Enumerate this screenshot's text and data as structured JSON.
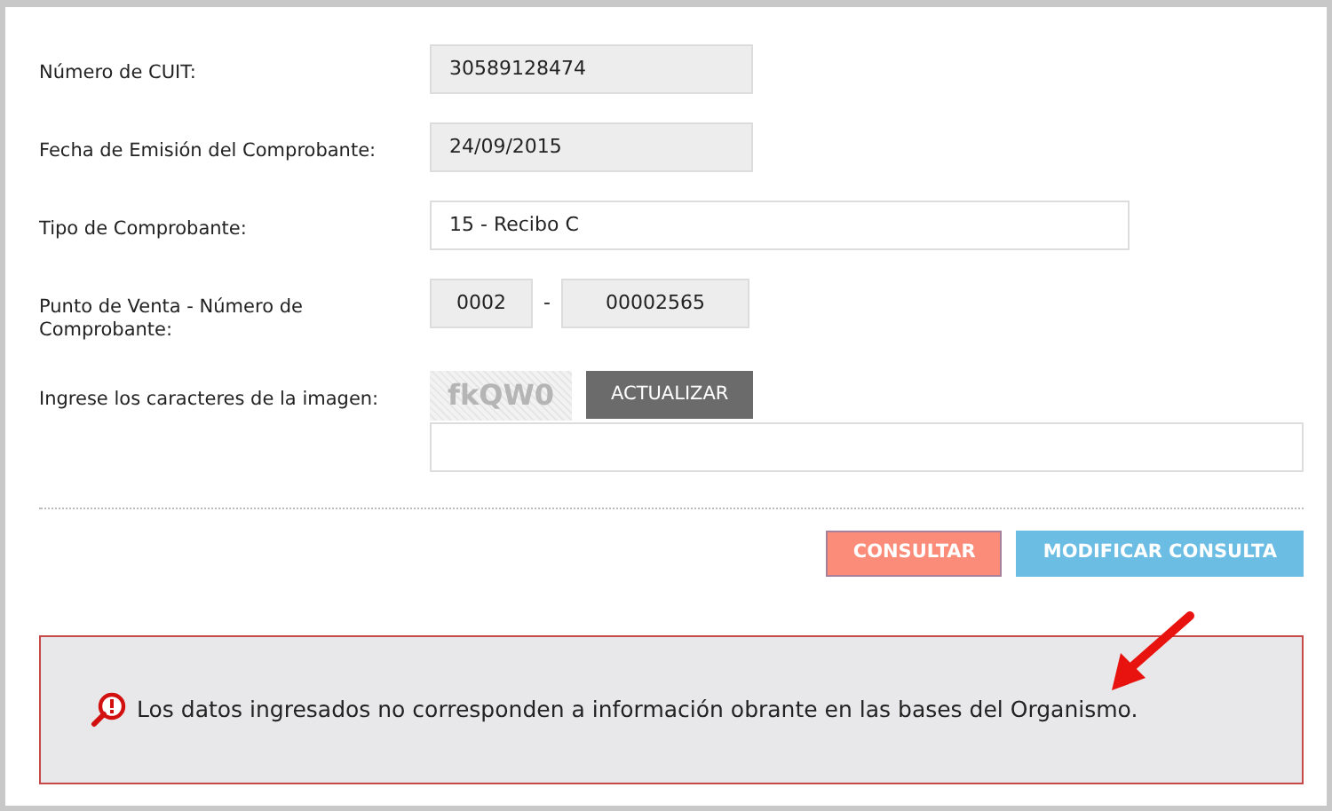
{
  "form": {
    "fields": [
      {
        "kind": "readonly",
        "label": "Número de CUIT:",
        "value": "30589128474"
      },
      {
        "kind": "readonly",
        "label": "Fecha de Emisión del Comprobante:",
        "value": "24/09/2015"
      },
      {
        "kind": "input",
        "label": "Tipo de Comprobante:",
        "value": "15 - Recibo C"
      },
      {
        "kind": "pair",
        "label": "Punto de Venta - Número de Comprobante:",
        "value": "0002",
        "separator": "-",
        "value_2": "00002565"
      },
      {
        "kind": "captcha",
        "label": "Ingrese los caracteres de la imagen:",
        "captcha_text": "fkQW0",
        "button": "ACTUALIZAR"
      }
    ]
  },
  "buttons": [
    {
      "label": "CONSULTAR",
      "kind": "primary"
    },
    {
      "label": "MODIFICAR CONSULTA",
      "kind": "secondary"
    }
  ],
  "alert": {
    "message": "Los datos ingresados no corresponden a información obrante en las bases del Organismo."
  }
}
